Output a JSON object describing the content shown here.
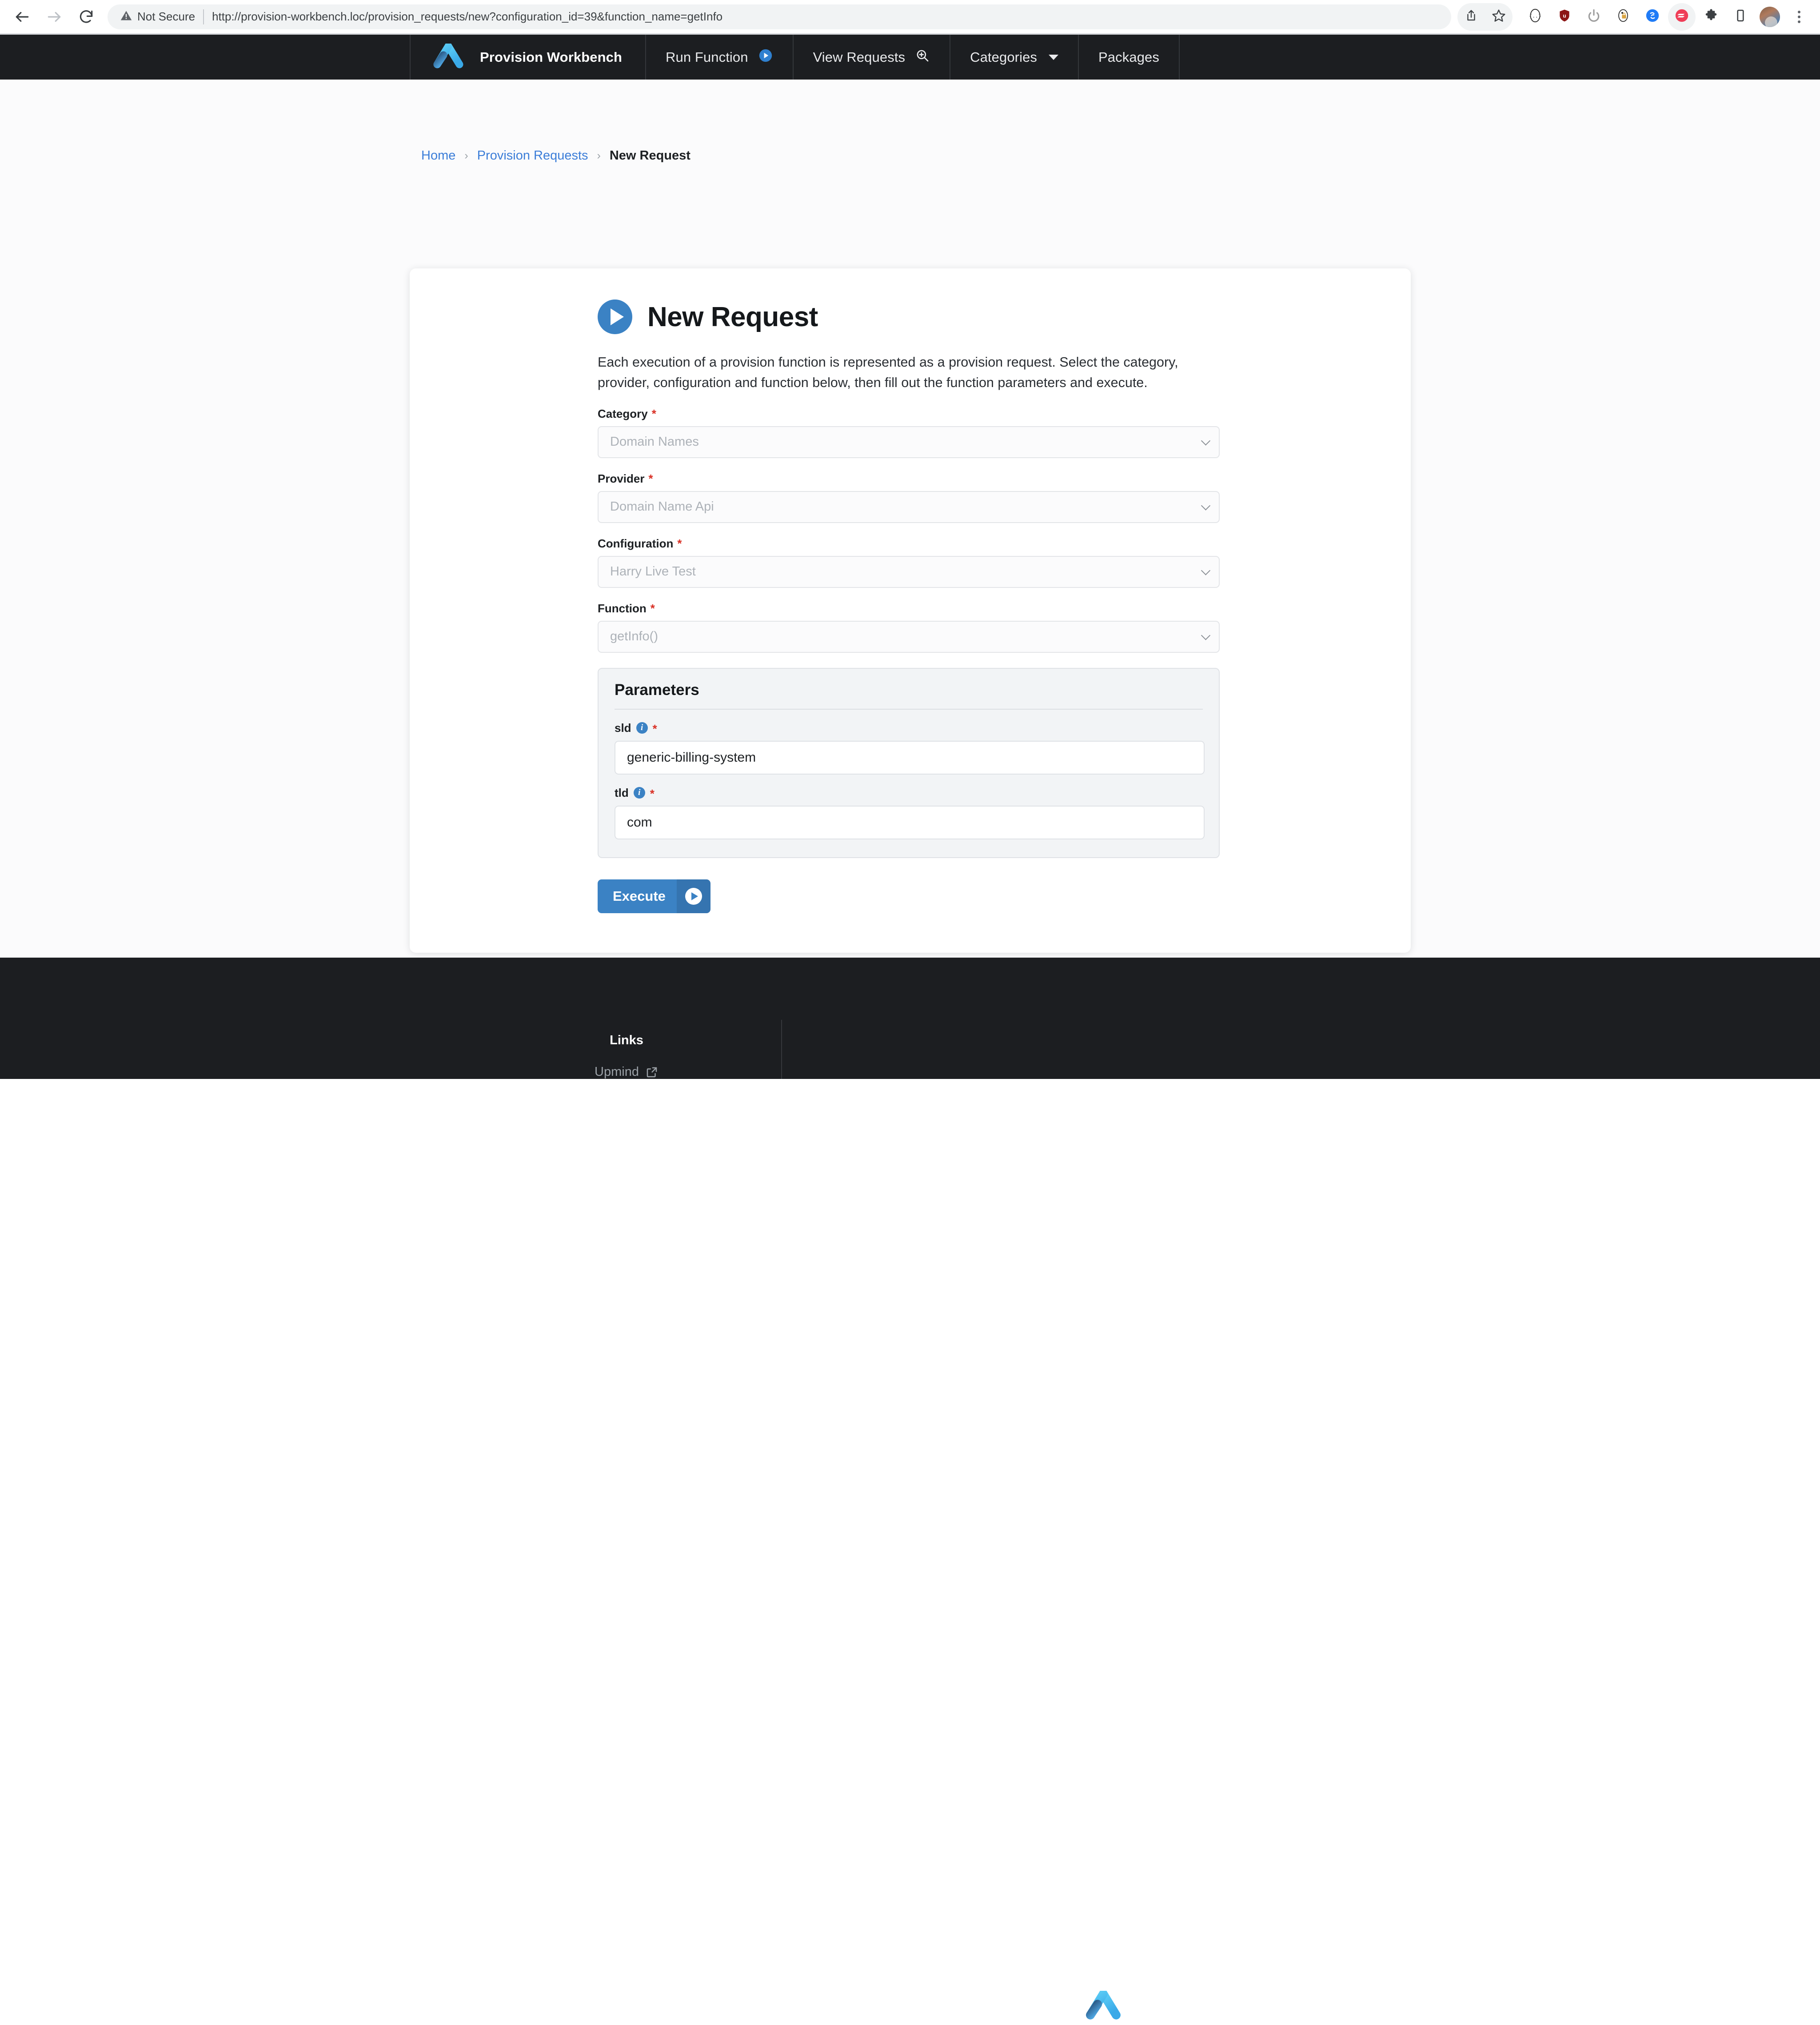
{
  "browser": {
    "back_icon": "back-arrow-icon",
    "forward_icon": "forward-arrow-icon",
    "reload_icon": "reload-icon",
    "security_label": "Not Secure",
    "url": "http://provision-workbench.loc/provision_requests/new?configuration_id=39&function_name=getInfo",
    "actions": [
      {
        "name": "share-icon"
      },
      {
        "name": "bookmark-star-icon"
      },
      {
        "name": "json-viewer-extension-icon"
      },
      {
        "name": "ublock-origin-extension-icon"
      },
      {
        "name": "power-toggle-extension-icon"
      },
      {
        "name": "password-manager-extension-icon"
      },
      {
        "name": "shazam-extension-icon"
      },
      {
        "name": "redirect-extension-icon"
      },
      {
        "name": "extensions-puzzle-icon"
      },
      {
        "name": "device-toolbar-icon"
      },
      {
        "name": "profile-avatar"
      },
      {
        "name": "chrome-menu-kebab-icon"
      }
    ]
  },
  "navbar": {
    "logo_name": "upmind-logo-icon",
    "brand": "Provision Workbench",
    "items": [
      {
        "label": "Run Function",
        "icon": "play-circle-icon"
      },
      {
        "label": "View Requests",
        "icon": "search-zoom-icon"
      },
      {
        "label": "Categories",
        "icon": "chevron-down-icon"
      },
      {
        "label": "Packages",
        "icon": ""
      }
    ]
  },
  "breadcrumb": {
    "home": "Home",
    "provision_requests": "Provision Requests",
    "current": "New Request",
    "separator": "›"
  },
  "card": {
    "title": "New Request",
    "title_icon": "play-circle-icon",
    "description": "Each execution of a provision function is represented as a provision request. Select the category, provider, configuration and function below, then fill out the function parameters and execute.",
    "required_marker": "*",
    "fields": [
      {
        "label": "Category",
        "value": "Domain Names",
        "required": true
      },
      {
        "label": "Provider",
        "value": "Domain Name Api",
        "required": true
      },
      {
        "label": "Configuration",
        "value": "Harry Live Test",
        "required": true
      },
      {
        "label": "Function",
        "value": "getInfo()",
        "required": true
      }
    ],
    "parameters": {
      "title": "Parameters",
      "items": [
        {
          "label": "sld",
          "value": "generic-billing-system",
          "required": true,
          "info_icon": "info-icon"
        },
        {
          "label": "tld",
          "value": "com",
          "required": true,
          "info_icon": "info-icon"
        }
      ]
    },
    "execute": {
      "label": "Execute",
      "icon": "play-circle-icon"
    }
  },
  "footer": {
    "heading": "Links",
    "link_label": "Upmind",
    "link_icon": "external-link-icon",
    "logo_name": "upmind-logo-icon"
  },
  "colors": {
    "accent_blue": "#3b82c4",
    "nav_dark": "#1c1e21",
    "required_red": "#d93025",
    "link_blue": "#3b7dd8",
    "page_bg": "#fbfbfc"
  }
}
